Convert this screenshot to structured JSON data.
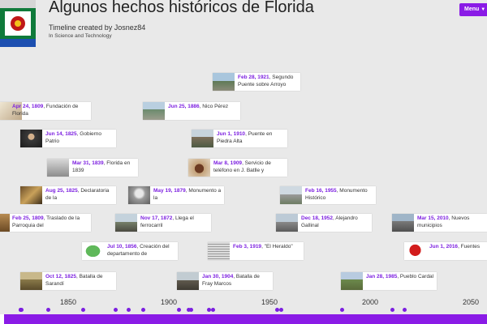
{
  "header": {
    "title": "Algunos hechos históricos de Florida",
    "subtitle": "Timeline created by Josnez84",
    "category": "In Science and Technology",
    "menu_label": "Menu",
    "logo_icon": "flag-logo"
  },
  "events": [
    {
      "date": "Feb 28, 1921",
      "text": ", Segundo Puente sobre Arroyo",
      "thumb": "bridge-photo"
    },
    {
      "date": "Apr 24, 1809",
      "text": ", Fundación de Florida",
      "thumb": "map-photo"
    },
    {
      "date": "Jun 25, 1886",
      "text": ", Nico Pérez",
      "thumb": "town-photo"
    },
    {
      "date": "Jun 14, 1825",
      "text": ", Gobierno Patrio",
      "thumb": "portrait-photo"
    },
    {
      "date": "Jun 1, 1910",
      "text": ", Puente en Piedra Alta",
      "thumb": "stone-bridge-photo"
    },
    {
      "date": "Mar 31, 1839",
      "text": ", Florida en 1839",
      "thumb": "sketch-photo"
    },
    {
      "date": "Mar 8, 1909",
      "text": ", Servicio de teléfono en J. Batlle y",
      "thumb": "telephone-photo"
    },
    {
      "date": "Aug 25, 1825",
      "text": ", Declaratoria de la",
      "thumb": "painting-photo"
    },
    {
      "date": "May 19, 1879",
      "text": ", Monumento a la",
      "thumb": "bearded-man-photo"
    },
    {
      "date": "Feb 16, 1955",
      "text": ", Monumento Histórico",
      "thumb": "monument-photo"
    },
    {
      "date": "Feb 25, 1809",
      "text": ", Traslado de la Parroquia del",
      "thumb": "church-painting"
    },
    {
      "date": "Nov 17, 1872",
      "text": ", Llega el ferrocarril",
      "thumb": "railway-photo"
    },
    {
      "date": "Dec 18, 1952",
      "text": ", Alejandro Gallinal",
      "thumb": "city-photo"
    },
    {
      "date": "Mar 15, 2010",
      "text": ", Nuevos municipios",
      "thumb": "building-photo"
    },
    {
      "date": "Jul 10, 1856",
      "text": ", Creación del departamento de",
      "thumb": "green-map"
    },
    {
      "date": "Feb 3, 1919",
      "text": ", \"El Heraldo\"",
      "thumb": "newspaper-photo"
    },
    {
      "date": "Jun 1, 2016",
      "text": ", Fuentes",
      "thumb": "info-logo"
    },
    {
      "date": "Oct 12, 1825",
      "text": ", Batalla de Sarandí",
      "thumb": "battle-painting"
    },
    {
      "date": "Jan 30, 1904",
      "text": ", Batalla de Fray Marcos",
      "thumb": "statue-photo"
    },
    {
      "date": "Jan 28, 1985",
      "text": ", Pueblo Cardal",
      "thumb": "cows-photo"
    }
  ],
  "axis": {
    "labels": [
      "1850",
      "1900",
      "1950",
      "2000",
      "2050"
    ],
    "event_years": [
      1809.1,
      1809.3,
      1825.4,
      1825.5,
      1825.6,
      1825.8,
      1839.2,
      1856.5,
      1872.9,
      1879.4,
      1886.5,
      1904.1,
      1909.2,
      1910.4,
      1919.1,
      1921.2,
      1952.9,
      1955.1,
      1985.1,
      2010.2,
      2016.4
    ]
  },
  "colors": {
    "accent": "#8a1be6",
    "date": "#7c1fe0",
    "background": "#e9e9e9"
  }
}
